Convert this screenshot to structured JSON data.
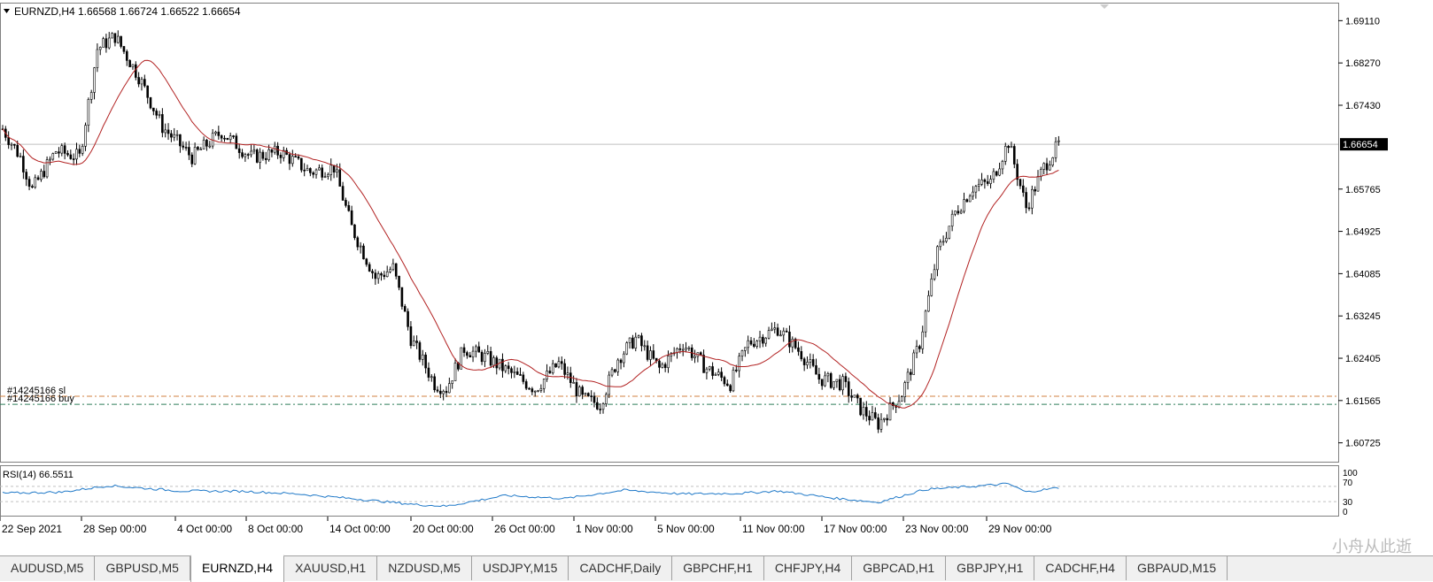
{
  "header": {
    "title": "EURNZD,H4",
    "ohlc": "1.66568 1.66724 1.66522 1.66654"
  },
  "indicator": {
    "label": "RSI(14) 66.5511",
    "levels": [
      "100",
      "70",
      "30",
      "0"
    ]
  },
  "trade_lines": {
    "sl_label": "#14245166 sl",
    "buy_label": "#14245166 buy",
    "sl_price": 1.6165,
    "buy_price": 1.6149
  },
  "price_axis": {
    "ticks": [
      "1.69110",
      "1.68270",
      "1.67430",
      "1.66654",
      "1.65765",
      "1.64925",
      "1.64085",
      "1.63245",
      "1.62405",
      "1.61565",
      "1.60725"
    ],
    "current": "1.66654"
  },
  "time_axis": {
    "ticks": [
      "22 Sep 2021",
      "28 Sep 00:00",
      "4 Oct 00:00",
      "8 Oct 00:00",
      "14 Oct 00:00",
      "20 Oct 00:00",
      "26 Oct 00:00",
      "1 Nov 00:00",
      "5 Nov 00:00",
      "11 Nov 00:00",
      "17 Nov 00:00",
      "23 Nov 00:00",
      "29 Nov 00:00"
    ]
  },
  "tabs": [
    {
      "label": "AUDUSD,M5",
      "active": false
    },
    {
      "label": "GBPUSD,M5",
      "active": false
    },
    {
      "label": "EURNZD,H4",
      "active": true
    },
    {
      "label": "XAUUSD,H1",
      "active": false
    },
    {
      "label": "NZDUSD,M5",
      "active": false
    },
    {
      "label": "USDJPY,M15",
      "active": false
    },
    {
      "label": "CADCHF,Daily",
      "active": false
    },
    {
      "label": "GBPCHF,H1",
      "active": false
    },
    {
      "label": "CHFJPY,H4",
      "active": false
    },
    {
      "label": "GBPCAD,H1",
      "active": false
    },
    {
      "label": "GBPJPY,H1",
      "active": false
    },
    {
      "label": "CADCHF,H4",
      "active": false
    },
    {
      "label": "GBPAUD,M15",
      "active": false
    }
  ],
  "watermark": "小舟从此逝",
  "colors": {
    "ma": "#b22222",
    "rsi": "#1e78c8",
    "sl": "#d08040",
    "buy": "#2e7d5a",
    "candle": "#000000"
  },
  "chart_data": {
    "type": "candlestick",
    "symbol": "EURNZD",
    "timeframe": "H4",
    "ylim": [
      1.6035,
      1.6945
    ],
    "price_path": [
      [
        0,
        1.6696
      ],
      [
        6,
        1.664
      ],
      [
        10,
        1.6575
      ],
      [
        18,
        1.6652
      ],
      [
        26,
        1.664
      ],
      [
        32,
        1.6855
      ],
      [
        38,
        1.688
      ],
      [
        46,
        1.68
      ],
      [
        54,
        1.67
      ],
      [
        64,
        1.664
      ],
      [
        74,
        1.669
      ],
      [
        84,
        1.664
      ],
      [
        94,
        1.665
      ],
      [
        104,
        1.661
      ],
      [
        112,
        1.662
      ],
      [
        118,
        1.65
      ],
      [
        126,
        1.64
      ],
      [
        132,
        1.642
      ],
      [
        138,
        1.628
      ],
      [
        146,
        1.619
      ],
      [
        150,
        1.618
      ],
      [
        156,
        1.626
      ],
      [
        164,
        1.624
      ],
      [
        172,
        1.621
      ],
      [
        180,
        1.618
      ],
      [
        188,
        1.623
      ],
      [
        196,
        1.616
      ],
      [
        202,
        1.615
      ],
      [
        208,
        1.624
      ],
      [
        214,
        1.628
      ],
      [
        222,
        1.622
      ],
      [
        230,
        1.627
      ],
      [
        238,
        1.622
      ],
      [
        246,
        1.619
      ],
      [
        252,
        1.627
      ],
      [
        262,
        1.63
      ],
      [
        270,
        1.625
      ],
      [
        276,
        1.62
      ],
      [
        284,
        1.619
      ],
      [
        290,
        1.614
      ],
      [
        296,
        1.611
      ],
      [
        304,
        1.617
      ],
      [
        310,
        1.627
      ],
      [
        316,
        1.645
      ],
      [
        322,
        1.653
      ],
      [
        328,
        1.658
      ],
      [
        334,
        1.659
      ],
      [
        340,
        1.667
      ],
      [
        346,
        1.654
      ],
      [
        352,
        1.662
      ],
      [
        357,
        1.6665
      ]
    ],
    "rsi_path": [
      [
        0,
        52
      ],
      [
        20,
        55
      ],
      [
        36,
        72
      ],
      [
        60,
        58
      ],
      [
        82,
        57
      ],
      [
        100,
        50
      ],
      [
        118,
        38
      ],
      [
        140,
        22
      ],
      [
        150,
        18
      ],
      [
        170,
        46
      ],
      [
        190,
        38
      ],
      [
        210,
        60
      ],
      [
        230,
        50
      ],
      [
        250,
        52
      ],
      [
        262,
        58
      ],
      [
        280,
        40
      ],
      [
        296,
        28
      ],
      [
        312,
        62
      ],
      [
        328,
        70
      ],
      [
        340,
        77
      ],
      [
        346,
        55
      ],
      [
        357,
        66.55
      ]
    ]
  }
}
